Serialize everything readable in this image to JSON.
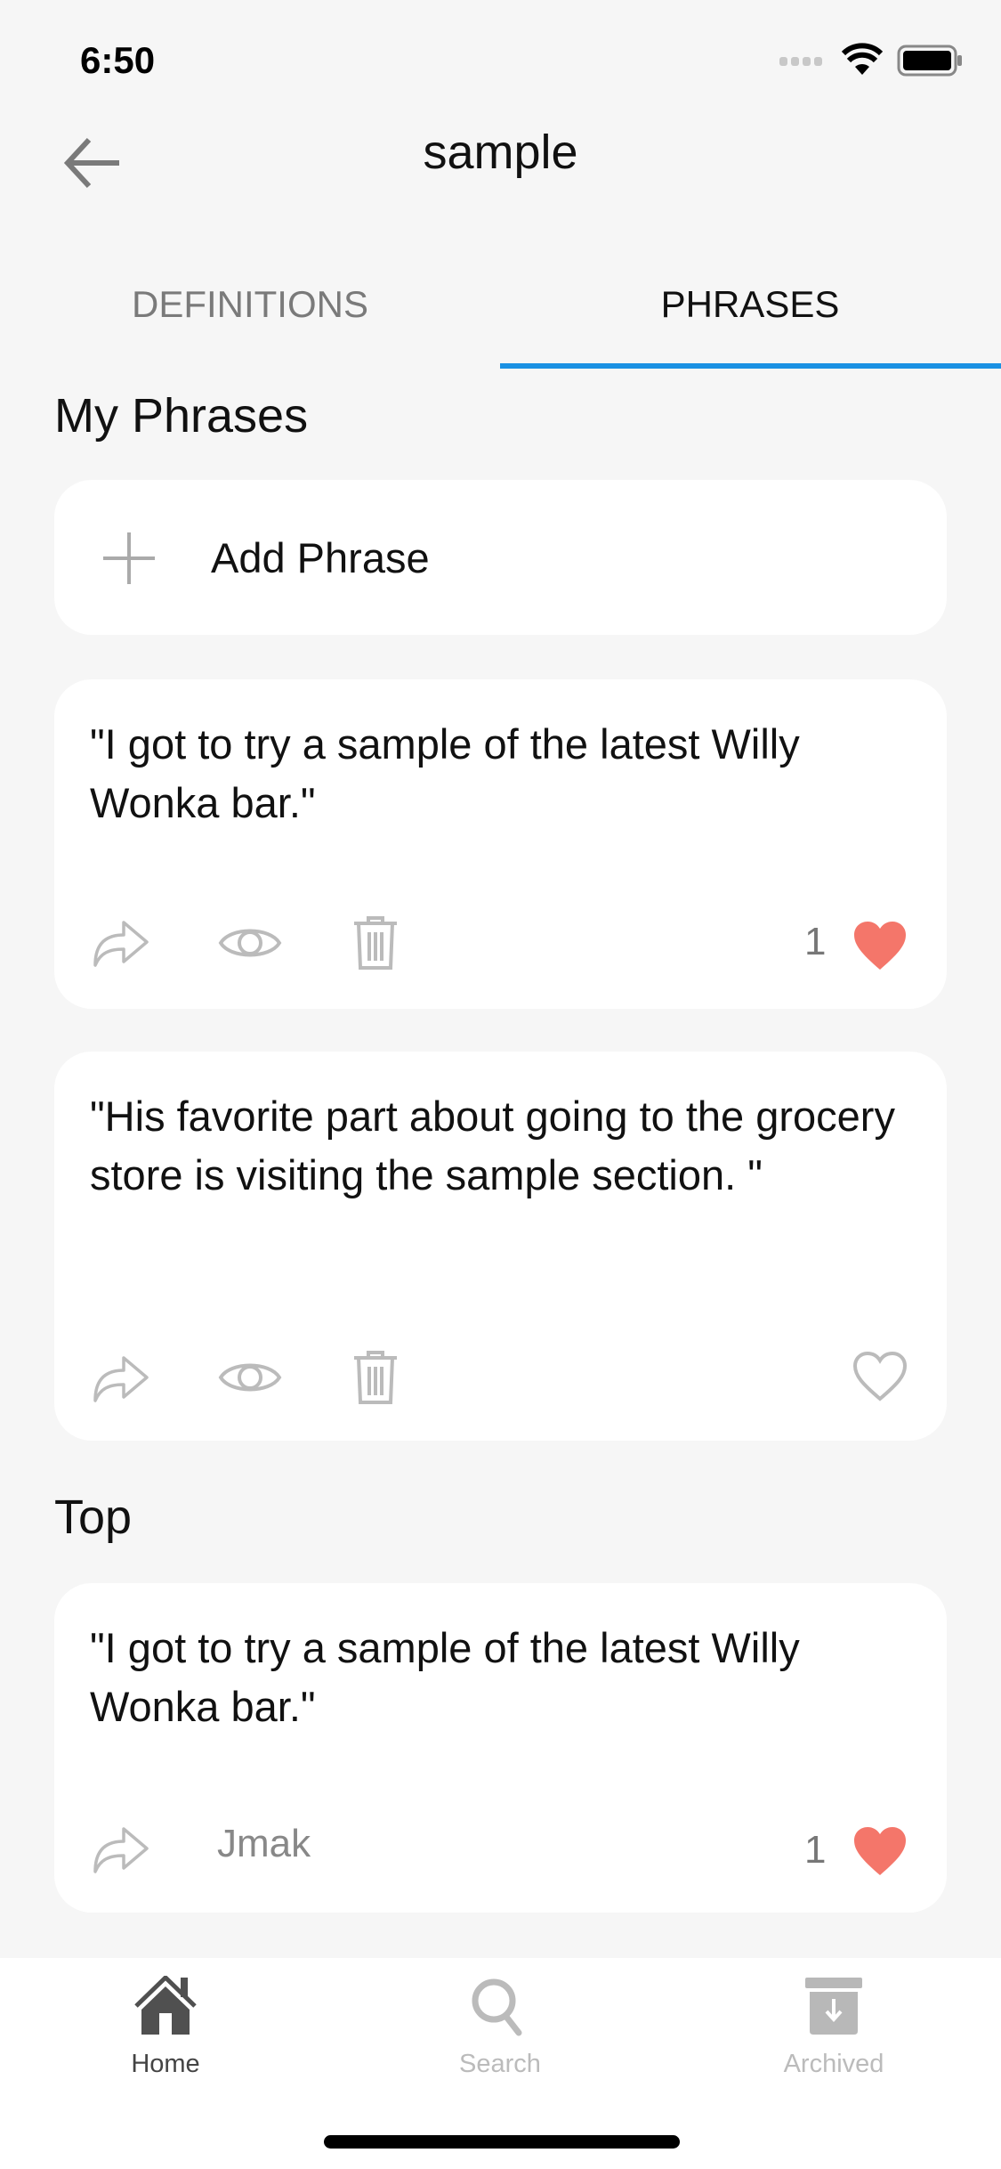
{
  "status_bar": {
    "time": "6:50"
  },
  "header": {
    "title": "sample",
    "back_icon": "arrow-left-icon"
  },
  "tabs": [
    {
      "label": "DEFINITIONS",
      "active": false
    },
    {
      "label": "PHRASES",
      "active": true
    }
  ],
  "accent_color": "#1a91e3",
  "heart_color": "#f4766a",
  "my_phrases": {
    "heading": "My Phrases",
    "add_label": "Add Phrase",
    "items": [
      {
        "text": "\"I got to try a sample of the latest Willy Wonka bar.\"",
        "likes": "1",
        "liked": true
      },
      {
        "text": "\"His favorite part about going to the grocery store is visiting the sample section. \"",
        "likes": "",
        "liked": false
      }
    ]
  },
  "top": {
    "heading": "Top",
    "items": [
      {
        "text": "\"I got to try a sample of the latest Willy Wonka bar.\"",
        "author": "Jmak",
        "likes": "1",
        "liked": true
      }
    ]
  },
  "bottom_nav": [
    {
      "label": "Home",
      "icon": "home-icon",
      "active": true
    },
    {
      "label": "Search",
      "icon": "search-icon",
      "active": false
    },
    {
      "label": "Archived",
      "icon": "archive-icon",
      "active": false
    }
  ]
}
